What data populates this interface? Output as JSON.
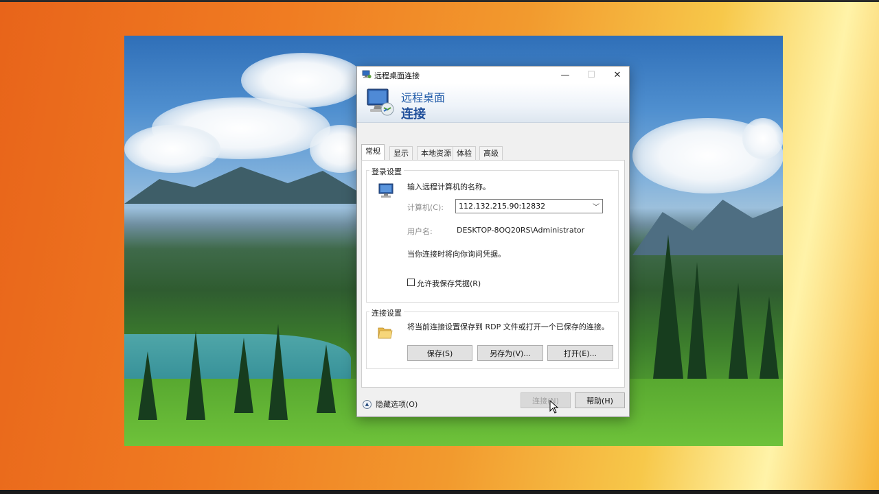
{
  "dialog": {
    "title": "远程桌面连接",
    "banner_line1": "远程桌面",
    "banner_line2": "连接",
    "window_controls": {
      "minimize": "—",
      "maximize": "☐",
      "close": "✕"
    }
  },
  "tabs": [
    {
      "label": "常规",
      "active": true
    },
    {
      "label": "显示",
      "active": false
    },
    {
      "label": "本地资源",
      "active": false
    },
    {
      "label": "体验",
      "active": false
    },
    {
      "label": "高级",
      "active": false
    }
  ],
  "logon": {
    "group_label": "登录设置",
    "instruction": "输入远程计算机的名称。",
    "computer_label": "计算机(C):",
    "computer_value": "112.132.215.90:12832",
    "username_label": "用户名:",
    "username_value": "DESKTOP-8OQ20RS\\Administrator",
    "credentials_note": "当你连接时将向你询问凭据。",
    "save_credentials_label": "允许我保存凭据(R)",
    "save_credentials_checked": false
  },
  "connection": {
    "group_label": "连接设置",
    "description": "将当前连接设置保存到 RDP 文件或打开一个已保存的连接。",
    "save_button": "保存(S)",
    "save_as_button": "另存为(V)...",
    "open_button": "打开(E)..."
  },
  "footer": {
    "hide_options": "隐藏选项(O)",
    "connect_button": "连接(N)",
    "help_button": "帮助(H)"
  },
  "icons": {
    "app": "remote-desktop-icon",
    "computer": "computer-icon",
    "folder": "folder-icon",
    "collapse": "chevron-up-icon",
    "dropdown": "chevron-down-icon"
  }
}
